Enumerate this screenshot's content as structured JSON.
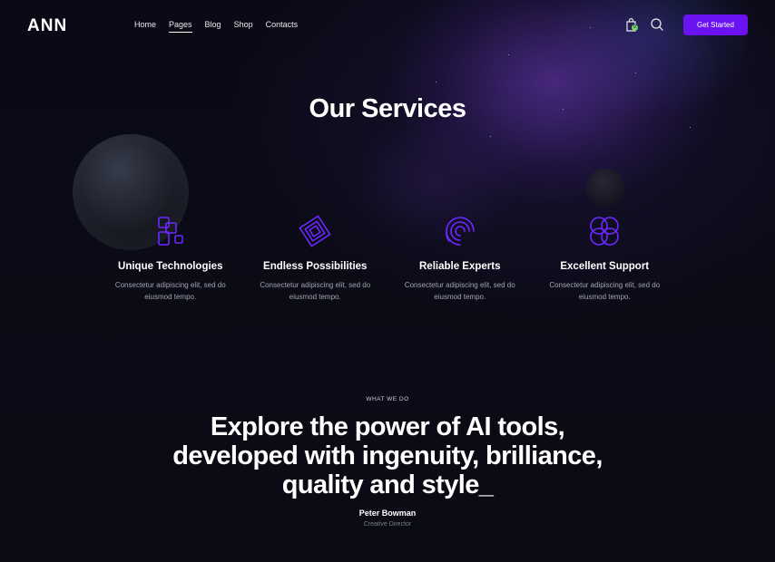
{
  "brand": {
    "logo": "ANN"
  },
  "nav": {
    "items": [
      "Home",
      "Pages",
      "Blog",
      "Shop",
      "Contacts"
    ],
    "active": "Pages"
  },
  "header": {
    "cart_count": "0",
    "cta_label": "Get Started",
    "cart_icon": "shopping-bag-icon",
    "search_icon": "search-icon"
  },
  "services": {
    "title": "Our Services",
    "items": [
      {
        "title": "Unique Technologies",
        "text": "Consectetur adipiscing elit, sed do eiusmod tempo.",
        "icon": "squares-icon"
      },
      {
        "title": "Endless Possibilities",
        "text": "Consectetur adipiscing elit, sed do eiusmod tempo.",
        "icon": "layered-diamond-icon"
      },
      {
        "title": "Reliable Experts",
        "text": "Consectetur adipiscing elit, sed do eiusmod tempo.",
        "icon": "spiral-icon"
      },
      {
        "title": "Excellent Support",
        "text": "Consectetur adipiscing elit, sed do eiusmod tempo.",
        "icon": "circles-icon"
      }
    ]
  },
  "about": {
    "eyebrow": "WHAT WE DO",
    "headline_line1": "Explore the power of AI tools,",
    "headline_line2": "developed with ingenuity, brilliance,",
    "headline_line3": "quality and style_",
    "author": "Peter Bowman",
    "role": "Creative Director"
  },
  "colors": {
    "accent": "#6b12f2",
    "icon": "#6d28ff",
    "background": "#0a0a14",
    "badge": "#7ad66b"
  }
}
